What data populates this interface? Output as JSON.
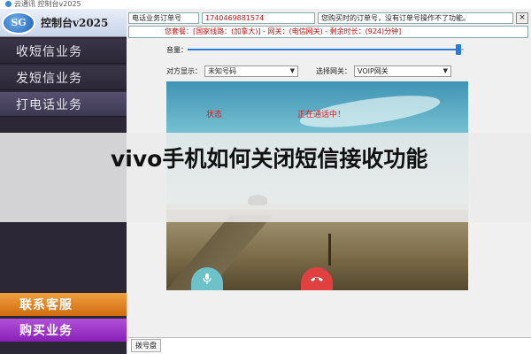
{
  "window": {
    "title": "云通讯 控制台v2025"
  },
  "logo": {
    "badge": "SG",
    "text": "控制台v2025"
  },
  "sidebar": {
    "items": [
      {
        "label": "收短信业务"
      },
      {
        "label": "发短信业务"
      },
      {
        "label": "打电话业务"
      }
    ],
    "service_label": "联系客服",
    "buy_label": "购买业务"
  },
  "header": {
    "order_label": "电话业务订单号",
    "order_value": "1740469881574",
    "notice": "您购买时的订单号，没有订单号操作不了功能。",
    "close": "×",
    "plan_line": "您套餐：[国家线路：(加拿大)] - 网关：(电信网关) - 剩余时长：(924)分钟]"
  },
  "volume": {
    "label": "音量：",
    "level": 0.98
  },
  "selectors": {
    "caller_label": "对方显示：",
    "caller_value": "未知号码",
    "gateway_label": "选择网关：",
    "gateway_value": "VOIP网关"
  },
  "call": {
    "status_label": "状态",
    "status_value": "正在通话中！",
    "mic_icon": "microphone-icon",
    "hangup_icon": "phone-hangup-icon"
  },
  "tabs": {
    "dialpad": "拨号盘"
  },
  "overlay": {
    "title": "vivo手机如何关闭短信接收功能"
  }
}
